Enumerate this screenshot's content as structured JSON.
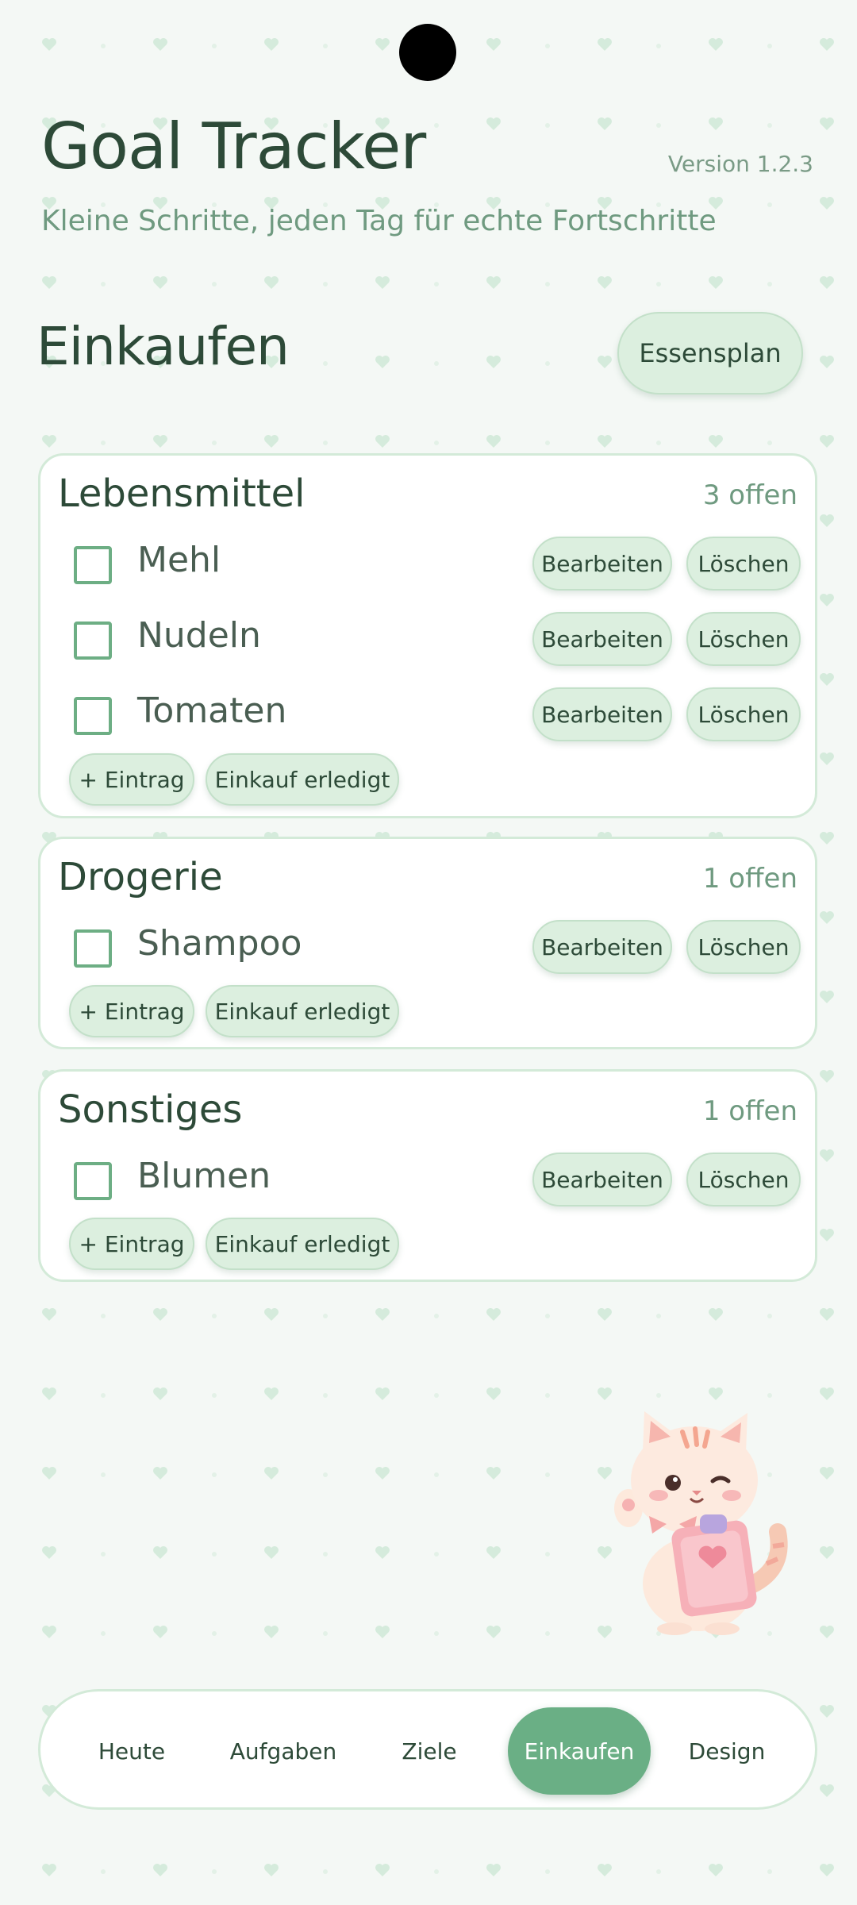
{
  "header": {
    "app_title": "Goal Tracker",
    "version": "Version 1.2.3",
    "subtitle": "Kleine Schritte, jeden Tag für echte Fortschritte"
  },
  "section": {
    "title": "Einkaufen",
    "meal_plan_label": "Essensplan"
  },
  "labels": {
    "edit": "Bearbeiten",
    "delete": "Löschen",
    "add_entry": "+ Eintrag",
    "purchase_done": "Einkauf erledigt"
  },
  "categories": [
    {
      "name": "Lebensmittel",
      "open_count": "3 offen",
      "items": [
        {
          "label": "Mehl",
          "checked": false
        },
        {
          "label": "Nudeln",
          "checked": false
        },
        {
          "label": "Tomaten",
          "checked": false
        }
      ]
    },
    {
      "name": "Drogerie",
      "open_count": "1 offen",
      "items": [
        {
          "label": "Shampoo",
          "checked": false
        }
      ]
    },
    {
      "name": "Sonstiges",
      "open_count": "1 offen",
      "items": [
        {
          "label": "Blumen",
          "checked": false
        }
      ]
    }
  ],
  "nav": {
    "items": [
      {
        "label": "Heute"
      },
      {
        "label": "Aufgaben"
      },
      {
        "label": "Ziele"
      },
      {
        "label": "Einkaufen"
      },
      {
        "label": "Design"
      }
    ],
    "active": "Einkaufen"
  },
  "mascot": {
    "icon": "cat-mascot-icon",
    "description_hidden": true
  },
  "colors": {
    "accent": "#6aaf85",
    "pill": "#dcefdf",
    "background": "#f4f8f5",
    "text": "#2d4a38"
  }
}
